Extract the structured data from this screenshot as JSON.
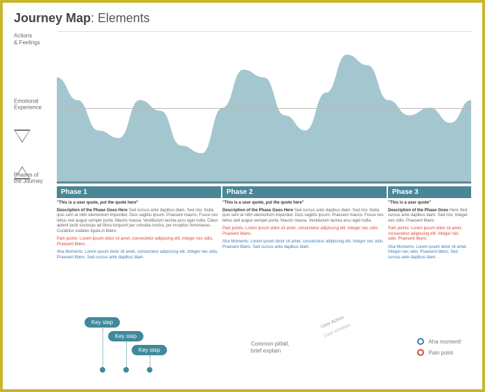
{
  "title_prefix": "Journey Map",
  "title_suffix": ": Elements",
  "axis": {
    "top": "Actions\n& Feelings",
    "mid": "Emotional\nExperience",
    "bot": "Phases of\nthe Journey"
  },
  "phases": [
    {
      "name": "Phase 1",
      "quote": "\"This is a user quote, put the quote here\"",
      "desc_head": "Description of the Phase Goes Here",
      "desc": " Sed cursus ante dapibus diam. Sed nisi. Nulla quis sem at nibh elementum imperdiet. Duis sagittis ipsum. Praesent mauris. Fusce nec tellus sed augue semper porta. Mauris massa. Vestibulum lacinia arcu eget nulla. Class aptent taciti sociosqu ad litora torquent per conubia nostra, per inceptos himenaeos. Curabitur sodales ligula in libero.",
      "pain": "Pain points: Lorem ipsum dolor sit amet, consectetur adipiscing elit. Integer nec odio. Praesent libero.",
      "aha": "Aha Moments: Lorem ipsum dolor sit amet, consectetur adipiscing elit. Integer nec odio. Praesent libero. Sed cursus ante dapibus diam."
    },
    {
      "name": "Phase 2",
      "quote": "\"This is a user quote, put the quote here\"",
      "desc_head": "Description of the Phase Goes Here",
      "desc": " Sed cursus ante dapibus diam. Sed nisi. Nulla quis sem at nibh elementum imperdiet. Duis sagittis ipsum. Praesent mauris. Fusce nec tellus sed augue semper porta. Mauris massa. Vestibulum lacinia arcu eget nulla.",
      "pain": "Pain points: Lorem ipsum dolor sit amet, consectetur adipiscing elit. Integer nec odio. Praesent libero.",
      "aha": "Aha Moments: Lorem ipsum dolor sit amet, consectetur adipiscing elit. Integer nec odio. Praesent libero. Sed cursus ante dapibus diam."
    },
    {
      "name": "Phase 3",
      "quote": "\"This is a user quote\"",
      "desc_head": "Description of the Phase Goes",
      "desc": " Here Sed cursus ante dapibus diam. Sed nisi. Integer nec odio. Praesent libero.",
      "pain": "Pain points: Lorem ipsum dolor sit amet, consectetur adipiscing elit. Integer nec odio. Praesent libero.",
      "aha": "Aha Moments: Lorem ipsum dolor sit amet. Integer nec odio. Praesent libero. Sed cursus ante dapibus diam."
    }
  ],
  "legend": {
    "step": "Key step",
    "pitfall": "Common pitfall,\nbrief explain",
    "user_action": "User Action",
    "user_emotion": "User emotion",
    "aha": "Aha moment!",
    "pain": "Pain point"
  },
  "chart_data": {
    "type": "area",
    "title": "Emotional Experience",
    "xlabel": "Phases of the Journey",
    "ylabel": "Actions & Feelings",
    "x": [
      0,
      5,
      10,
      15,
      20,
      25,
      30,
      35,
      40,
      45,
      50,
      55,
      60,
      65,
      70,
      75,
      80,
      85,
      90,
      95,
      100
    ],
    "values": [
      70,
      55,
      35,
      30,
      55,
      48,
      25,
      20,
      50,
      75,
      70,
      45,
      35,
      60,
      85,
      78,
      55,
      45,
      50,
      40,
      55
    ],
    "ylim": [
      0,
      100
    ],
    "baseline": 50
  }
}
